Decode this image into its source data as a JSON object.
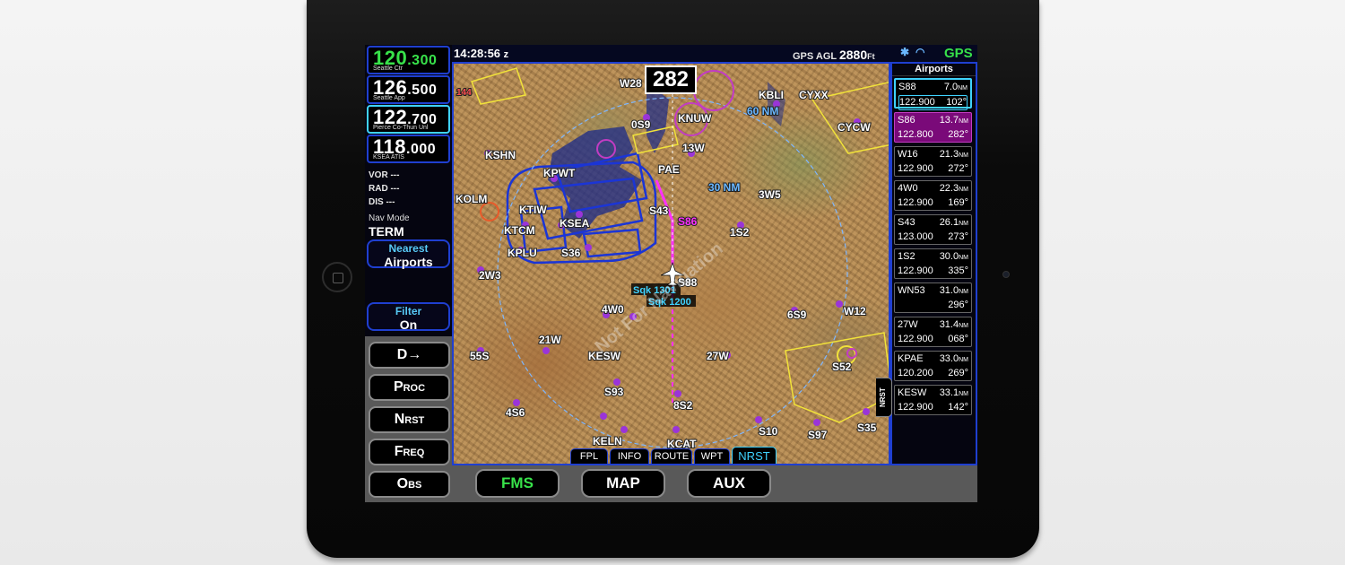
{
  "status": {
    "time": "14:28:56",
    "time_suffix": "z",
    "gps_agl_label": "GPS AGL",
    "gps_agl_value": "2880",
    "gps_agl_unit": "Ft",
    "gps": "GPS"
  },
  "freqs": [
    {
      "value": "120",
      "dec": ".300",
      "name": "Seattle Ctr"
    },
    {
      "value": "126",
      "dec": ".500",
      "name": "Seattle App"
    },
    {
      "value": "122",
      "dec": ".700",
      "name": "Pierce Co-Thun Unl"
    },
    {
      "value": "118",
      "dec": ".000",
      "name": "KSEA ATIS"
    }
  ],
  "nav": {
    "vor": "VOR ---",
    "rad": "RAD ---",
    "dis": "DIS  ---",
    "mode_label": "Nav Mode",
    "mode_value": "TERM"
  },
  "nearest": {
    "l1": "Nearest",
    "l2": "Airports"
  },
  "filter": {
    "l1": "Filter",
    "l2": "On"
  },
  "softkeys": [
    "D→",
    "Proc",
    "Nrst",
    "Freq",
    "Obs"
  ],
  "map": {
    "heading": "282",
    "watermark": "Not For Navigation",
    "ring_label": "30 NM",
    "ring_label_inner": "60 NM",
    "labels": [
      "KSHN",
      "KPWT",
      "KTIW",
      "KSEA",
      "KTCM",
      "KPLU",
      "S36",
      "KOLM",
      "2W3",
      "PAE",
      "S43",
      "S86",
      "S88",
      "4W0",
      "21W",
      "55S",
      "KESW",
      "S93",
      "4S6",
      "8S2",
      "KELN",
      "KCAT",
      "S10",
      "S97",
      "S35",
      "6S9",
      "W12",
      "S52",
      "1S2",
      "3W5",
      "13W",
      "KNUW",
      "0S9",
      "W28",
      "KBLI",
      "CYXX",
      "CYCW",
      "144",
      "27W"
    ],
    "tags": [
      "Sqk 1301",
      "Sqk 1200"
    ],
    "tabs": [
      "FPL",
      "INFO",
      "ROUTE",
      "WPT",
      "NRST"
    ]
  },
  "airports": {
    "title": "Airports",
    "items": [
      {
        "id": "S88",
        "dist": "7.0",
        "unit": "NM",
        "freq": "122.900",
        "brg": "102°"
      },
      {
        "id": "S86",
        "dist": "13.7",
        "unit": "NM",
        "freq": "122.800",
        "brg": "282°"
      },
      {
        "id": "W16",
        "dist": "21.3",
        "unit": "NM",
        "freq": "122.900",
        "brg": "272°"
      },
      {
        "id": "4W0",
        "dist": "22.3",
        "unit": "NM",
        "freq": "122.900",
        "brg": "169°"
      },
      {
        "id": "S43",
        "dist": "26.1",
        "unit": "NM",
        "freq": "123.000",
        "brg": "273°"
      },
      {
        "id": "1S2",
        "dist": "30.0",
        "unit": "NM",
        "freq": "122.900",
        "brg": "335°"
      },
      {
        "id": "WN53",
        "dist": "31.0",
        "unit": "NM",
        "freq": "",
        "brg": "296°"
      },
      {
        "id": "27W",
        "dist": "31.4",
        "unit": "NM",
        "freq": "122.900",
        "brg": "068°"
      },
      {
        "id": "KPAE",
        "dist": "33.0",
        "unit": "NM",
        "freq": "120.200",
        "brg": "269°"
      },
      {
        "id": "KESW",
        "dist": "33.1",
        "unit": "NM",
        "freq": "122.900",
        "brg": "142°"
      }
    ],
    "nrst_tab": "NRST"
  },
  "bottom": {
    "fms": "FMS",
    "map": "MAP",
    "aux": "AUX"
  },
  "colors": {
    "active_green": "#38e24a",
    "select_cyan": "#3fd3ff",
    "bezel": "#1f3fd0",
    "magenta": "#ff30ff"
  }
}
